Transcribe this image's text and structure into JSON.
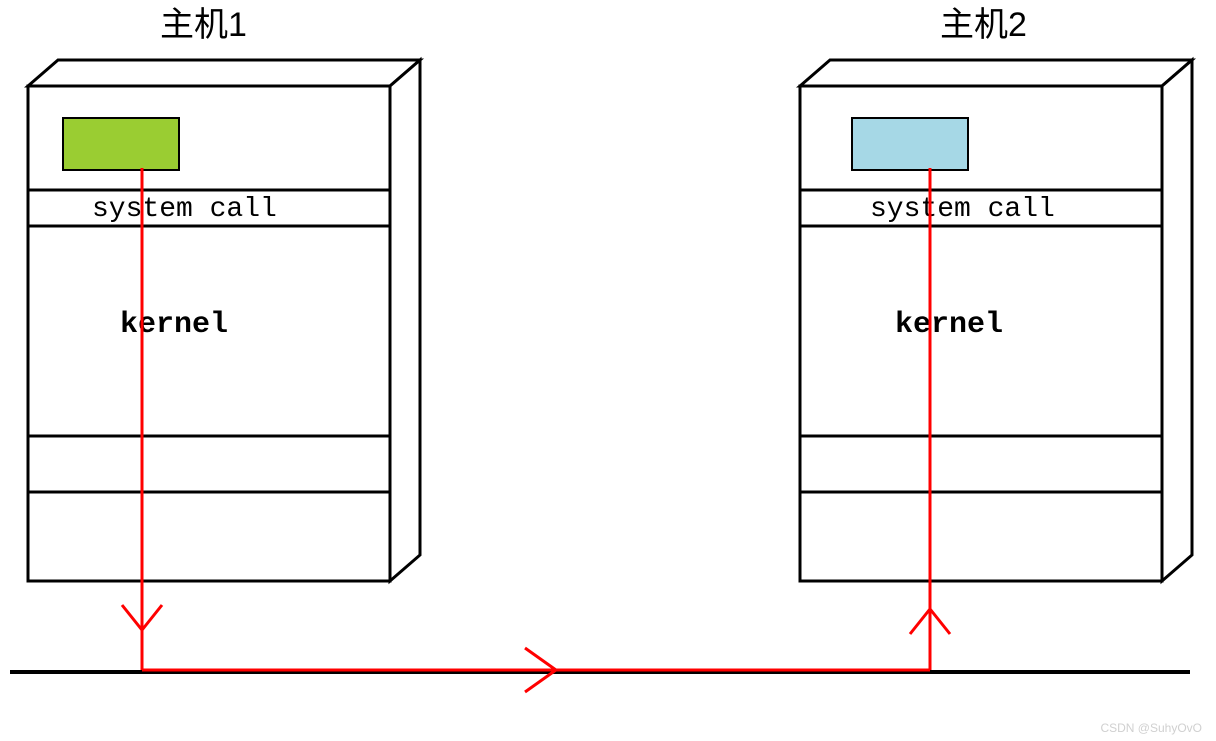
{
  "diagram": {
    "host1": {
      "title": "主机1",
      "syscall_label": "system call",
      "kernel_label": "kernel",
      "process_color": "#9ACD32"
    },
    "host2": {
      "title": "主机2",
      "syscall_label": "system call",
      "kernel_label": "kernel",
      "process_color": "#A6D8E6"
    },
    "flow_color": "#FF0000",
    "watermark": "CSDN @SuhyOvO"
  }
}
